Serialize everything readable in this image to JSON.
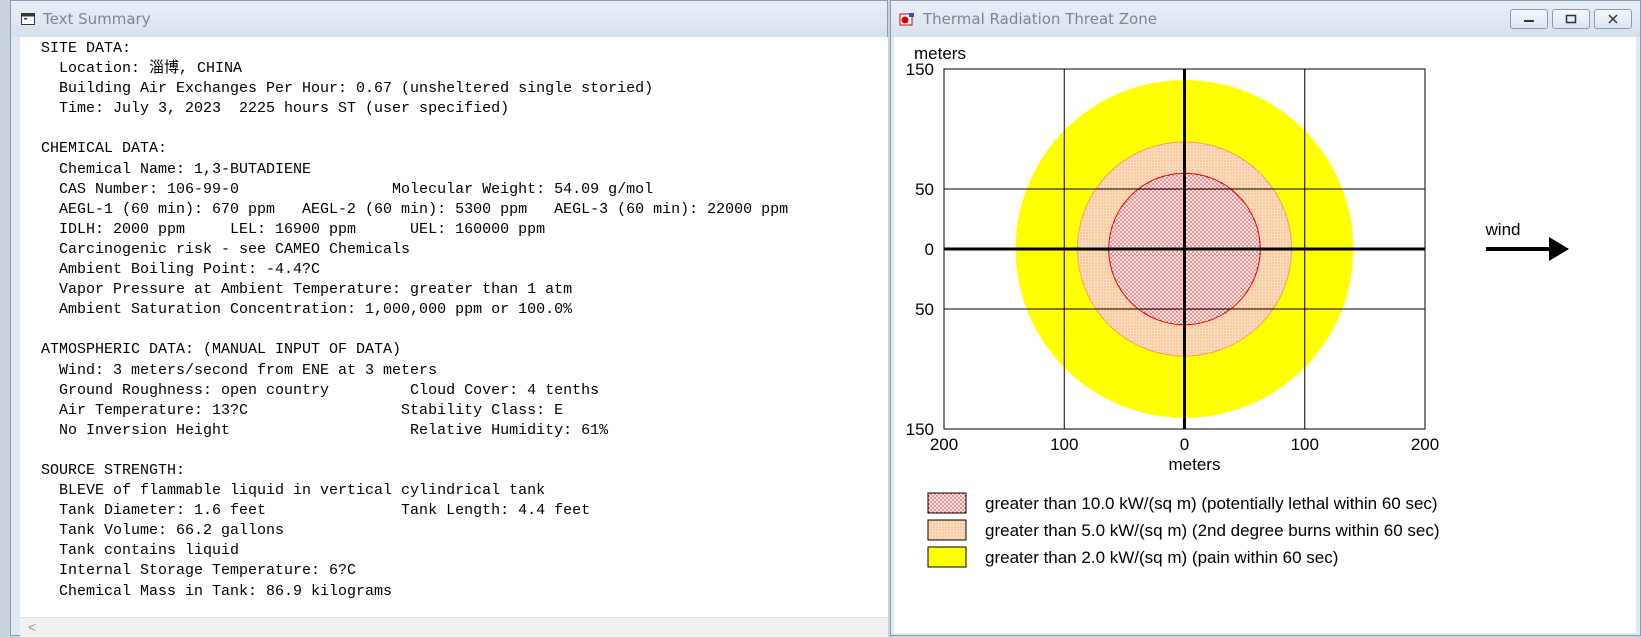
{
  "text_window": {
    "title": "Text Summary",
    "lines": [
      "SITE DATA:",
      "  Location: 淄博, CHINA",
      "  Building Air Exchanges Per Hour: 0.67 (unsheltered single storied)",
      "  Time: July 3, 2023  2225 hours ST (user specified)",
      "",
      "CHEMICAL DATA:",
      "  Chemical Name: 1,3-BUTADIENE",
      "  CAS Number: 106-99-0                 Molecular Weight: 54.09 g/mol",
      "  AEGL-1 (60 min): 670 ppm   AEGL-2 (60 min): 5300 ppm   AEGL-3 (60 min): 22000 ppm",
      "  IDLH: 2000 ppm     LEL: 16900 ppm      UEL: 160000 ppm",
      "  Carcinogenic risk - see CAMEO Chemicals",
      "  Ambient Boiling Point: -4.4?C",
      "  Vapor Pressure at Ambient Temperature: greater than 1 atm",
      "  Ambient Saturation Concentration: 1,000,000 ppm or 100.0%",
      "",
      "ATMOSPHERIC DATA: (MANUAL INPUT OF DATA)",
      "  Wind: 3 meters/second from ENE at 3 meters",
      "  Ground Roughness: open country         Cloud Cover: 4 tenths",
      "  Air Temperature: 13?C                 Stability Class: E",
      "  No Inversion Height                    Relative Humidity: 61%",
      "",
      "SOURCE STRENGTH:",
      "  BLEVE of flammable liquid in vertical cylindrical tank",
      "  Tank Diameter: 1.6 feet               Tank Length: 4.4 feet",
      "  Tank Volume: 66.2 gallons",
      "  Tank contains liquid",
      "  Internal Storage Temperature: 6?C",
      "  Chemical Mass in Tank: 86.9 kilograms"
    ],
    "scroll_left_glyph": "<"
  },
  "chart_window": {
    "title": "Thermal Radiation Threat Zone",
    "buttons": {
      "minimize": "–",
      "restore": "⧉",
      "close": "✕"
    }
  },
  "chart_data": {
    "type": "threat-zone-map",
    "y_unit_label": "meters",
    "x_unit_label": "meters",
    "xlim": [
      -200,
      200
    ],
    "ylim": [
      -150,
      150
    ],
    "x_ticks": [
      -200,
      -100,
      0,
      100,
      200
    ],
    "x_tick_labels": [
      "200",
      "100",
      "0",
      "100",
      "200"
    ],
    "y_ticks": [
      150,
      50,
      0,
      -50,
      -150
    ],
    "y_tick_labels": [
      "150",
      "50",
      "0",
      "50",
      "150"
    ],
    "grid": true,
    "wind_label": "wind",
    "wind_direction": "right",
    "zones": [
      {
        "threshold": "greater than 2.0 kW/(sq m) (pain within 60 sec)",
        "radius_m": 140,
        "fill": "#ffff00",
        "stroke": "#ffff00",
        "pattern": "solid"
      },
      {
        "threshold": "greater than 5.0 kW/(sq m) (2nd degree burns within 60 sec)",
        "radius_m": 89,
        "fill": "#fbd5b2",
        "stroke": "#ff9966",
        "pattern": "dots-light"
      },
      {
        "threshold": "greater than 10.0 kW/(sq m) (potentially lethal within 60 sec)",
        "radius_m": 63,
        "fill": "#ffe6e6",
        "stroke": "#e00000",
        "pattern": "dots-red"
      }
    ],
    "legend": [
      {
        "label": "greater than 10.0 kW/(sq m) (potentially lethal within 60 sec)",
        "pattern": "dots-red"
      },
      {
        "label": "greater than 5.0 kW/(sq m) (2nd degree burns within 60 sec)",
        "pattern": "dots-light"
      },
      {
        "label": "greater than 2.0 kW/(sq m) (pain within 60 sec)",
        "pattern": "solid"
      }
    ],
    "colors": {
      "axis": "#000000",
      "grid": "#000000",
      "yellow": "#ffff00",
      "orange_edge": "#ff9966",
      "red_edge": "#e00000"
    }
  }
}
